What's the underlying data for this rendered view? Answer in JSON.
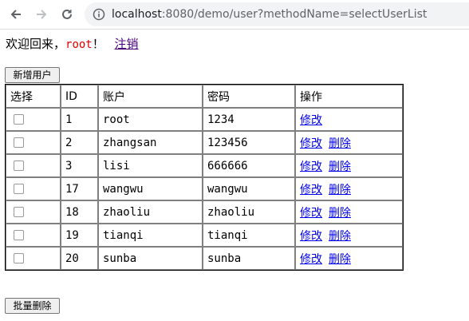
{
  "browser": {
    "url_host": "localhost",
    "url_path": ":8080/demo/user?methodName=selectUserList"
  },
  "welcome": {
    "prefix": "欢迎回来，",
    "username": "root",
    "suffix": "！",
    "logout_label": "注销"
  },
  "toolbar": {
    "add_user_label": "新增用户",
    "batch_delete_label": "批量删除"
  },
  "table": {
    "headers": {
      "select": "选择",
      "id": "ID",
      "account": "账户",
      "password": "密码",
      "actions": "操作"
    },
    "edit_label": "修改",
    "delete_label": "删除",
    "rows": [
      {
        "id": "1",
        "account": "root",
        "password": "1234",
        "deletable": false
      },
      {
        "id": "2",
        "account": "zhangsan",
        "password": "123456",
        "deletable": true
      },
      {
        "id": "3",
        "account": "lisi",
        "password": "666666",
        "deletable": true
      },
      {
        "id": "17",
        "account": "wangwu",
        "password": "wangwu",
        "deletable": true
      },
      {
        "id": "18",
        "account": "zhaoliu",
        "password": "zhaoliu",
        "deletable": true
      },
      {
        "id": "19",
        "account": "tianqi",
        "password": "tianqi",
        "deletable": true
      },
      {
        "id": "20",
        "account": "sunba",
        "password": "sunba",
        "deletable": true
      }
    ]
  }
}
